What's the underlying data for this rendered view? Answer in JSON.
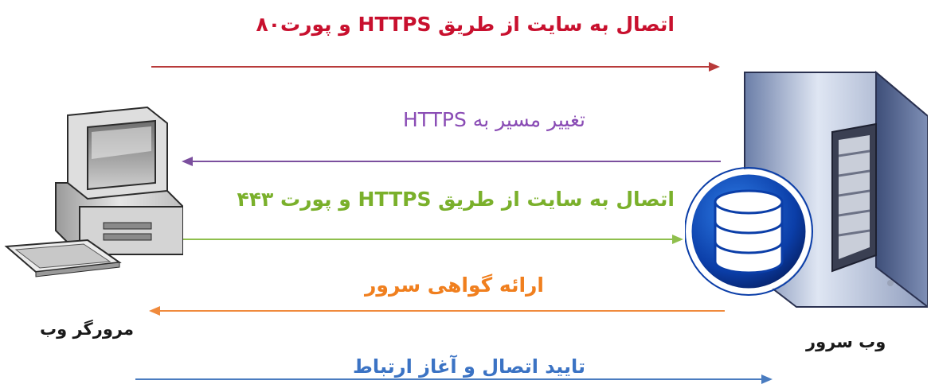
{
  "nodes": {
    "client": {
      "label": "مرورگر وب",
      "icon": "desktop-computer-icon"
    },
    "server": {
      "label": "وب سرور",
      "icon": "database-server-icon"
    }
  },
  "messages": [
    {
      "text": "اتصال به سایت از طریق HTTPS و پورت۸۰",
      "color": "#c8102e",
      "direction": "client-to-server"
    },
    {
      "text": "تغییر مسیر به HTTPS",
      "color": "#8a4cb5",
      "direction": "server-to-client"
    },
    {
      "text": "اتصال به سایت از طریق HTTPS  و پورت ۴۴۳",
      "color": "#7ab02b",
      "direction": "client-to-server"
    },
    {
      "text": "ارائه گواهی سرور",
      "color": "#f07f1e",
      "direction": "server-to-client"
    },
    {
      "text": "تایید اتصال و آغاز ارتباط",
      "color": "#3b73c4",
      "direction": "client-to-server"
    }
  ],
  "colors": {
    "arrow1": "#b83a3a",
    "arrow2": "#7b4f9e",
    "arrow3": "#8fbf4d",
    "arrow4": "#f08a3c",
    "arrow5": "#4a7cc0"
  }
}
